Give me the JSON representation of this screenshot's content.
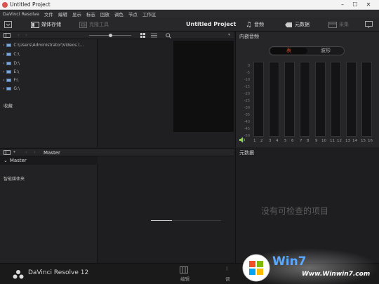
{
  "window": {
    "title": "Untitled Project"
  },
  "menu": [
    "DaVinci Resolve",
    "文件",
    "编辑",
    "显示",
    "标志",
    "回放",
    "调色",
    "节点",
    "工作区"
  ],
  "toolbar": {
    "media_storage": "媒体存储",
    "clone_tool": "克隆工具",
    "project_name": "Untitled Project",
    "audio": "音频",
    "metadata": "元数据",
    "capture": "采集"
  },
  "file_tree": {
    "items": [
      "C:\\Users\\Administrator\\Videos (...",
      "C:\\",
      "D:\\",
      "E:\\",
      "F:\\",
      "G:\\"
    ],
    "favorites_label": "收藏"
  },
  "audio_panel": {
    "header": "内嵌音频",
    "toggle": [
      "表",
      "波形"
    ],
    "scale": [
      "0",
      "-5",
      "-10",
      "-15",
      "-20",
      "-25",
      "-30",
      "-35",
      "-40",
      "-45",
      "-50"
    ],
    "channels": [
      "1",
      "2",
      "3",
      "4",
      "5",
      "6",
      "7",
      "8",
      "9",
      "10",
      "11",
      "12",
      "13",
      "14",
      "15",
      "16"
    ]
  },
  "bin": {
    "path": "Master",
    "root": "Master",
    "smart_bins": "智能媒体夹"
  },
  "metadata_panel": {
    "header": "元数据",
    "empty_message": "没有可检查的项目"
  },
  "bottom": {
    "brand": "DaVinci Resolve 12",
    "edit_label": "编辑",
    "color_label": "调"
  },
  "watermark": {
    "brand": "Win7",
    "url": "Www.Winwin7.com"
  },
  "colors": {
    "accent": "#e0452f",
    "background": "#1e1e20",
    "panel": "#262628"
  }
}
